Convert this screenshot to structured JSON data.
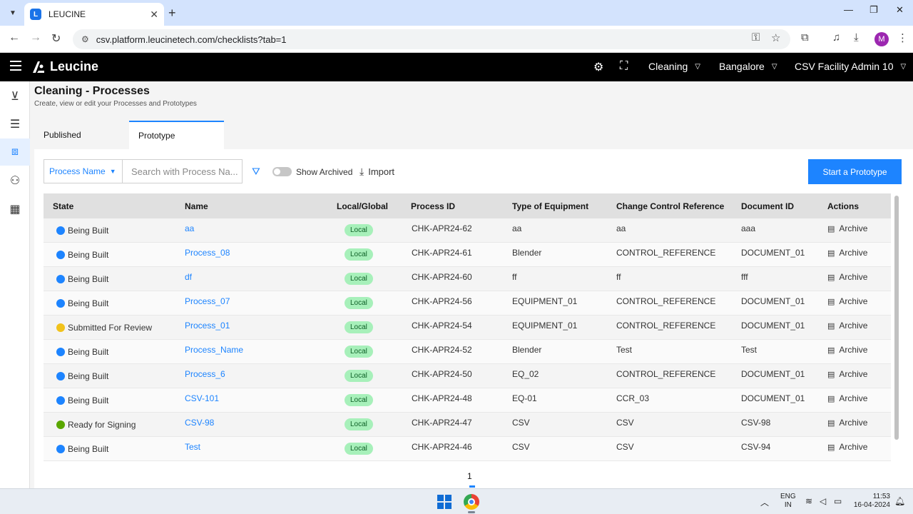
{
  "browser": {
    "tab_title": "LEUCINE",
    "url": "csv.platform.leucinetech.com/checklists?tab=1",
    "avatar_letter": "M"
  },
  "header": {
    "brand": "Leucine",
    "use_case": "Cleaning",
    "facility": "Bangalore",
    "user": "CSV Facility Admin 10"
  },
  "page": {
    "title": "Cleaning - Processes",
    "subtitle": "Create, view or edit your Processes and Prototypes",
    "tabs": [
      {
        "label": "Published"
      },
      {
        "label": "Prototype"
      }
    ]
  },
  "toolbar": {
    "filter_field": "Process Name",
    "search_placeholder": "Search with Process Na...",
    "show_archived_label": "Show Archived",
    "import_label": "Import",
    "primary_label": "Start a Prototype"
  },
  "table": {
    "headers": {
      "state": "State",
      "name": "Name",
      "local_global": "Local/Global",
      "process_id": "Process ID",
      "equipment": "Type of Equipment",
      "ccr": "Change Control Reference",
      "doc_id": "Document ID",
      "actions": "Actions"
    },
    "rows": [
      {
        "state": "Being Built",
        "state_color": "#1d84ff",
        "name": "aa",
        "scope": "Local",
        "pid": "CHK-APR24-62",
        "equipment": "aa",
        "ccr": "aa",
        "doc": "aaa",
        "action": "Archive"
      },
      {
        "state": "Being Built",
        "state_color": "#1d84ff",
        "name": "Process_08",
        "scope": "Local",
        "pid": "CHK-APR24-61",
        "equipment": "Blender",
        "ccr": "CONTROL_REFERENCE",
        "doc": "DOCUMENT_01",
        "action": "Archive"
      },
      {
        "state": "Being Built",
        "state_color": "#1d84ff",
        "name": "df",
        "scope": "Local",
        "pid": "CHK-APR24-60",
        "equipment": "ff",
        "ccr": "ff",
        "doc": "fff",
        "action": "Archive"
      },
      {
        "state": "Being Built",
        "state_color": "#1d84ff",
        "name": "Process_07",
        "scope": "Local",
        "pid": "CHK-APR24-56",
        "equipment": "EQUIPMENT_01",
        "ccr": "CONTROL_REFERENCE",
        "doc": "DOCUMENT_01",
        "action": "Archive"
      },
      {
        "state": "Submitted For Review",
        "state_color": "#f1c21b",
        "name": "Process_01",
        "scope": "Local",
        "pid": "CHK-APR24-54",
        "equipment": "EQUIPMENT_01",
        "ccr": "CONTROL_REFERENCE",
        "doc": "DOCUMENT_01",
        "action": "Archive"
      },
      {
        "state": "Being Built",
        "state_color": "#1d84ff",
        "name": "Process_Name",
        "scope": "Local",
        "pid": "CHK-APR24-52",
        "equipment": "Blender",
        "ccr": "Test",
        "doc": "Test",
        "action": "Archive"
      },
      {
        "state": "Being Built",
        "state_color": "#1d84ff",
        "name": "Process_6",
        "scope": "Local",
        "pid": "CHK-APR24-50",
        "equipment": "EQ_02",
        "ccr": "CONTROL_REFERENCE",
        "doc": "DOCUMENT_01",
        "action": "Archive"
      },
      {
        "state": "Being Built",
        "state_color": "#1d84ff",
        "name": "CSV-101",
        "scope": "Local",
        "pid": "CHK-APR24-48",
        "equipment": "EQ-01",
        "ccr": "CCR_03",
        "doc": "DOCUMENT_01",
        "action": "Archive"
      },
      {
        "state": "Ready for Signing",
        "state_color": "#5aa700",
        "name": "CSV-98",
        "scope": "Local",
        "pid": "CHK-APR24-47",
        "equipment": "CSV",
        "ccr": "CSV",
        "doc": "CSV-98",
        "action": "Archive"
      },
      {
        "state": "Being Built",
        "state_color": "#1d84ff",
        "name": "Test",
        "scope": "Local",
        "pid": "CHK-APR24-46",
        "equipment": "CSV",
        "ccr": "CSV",
        "doc": "CSV-94",
        "action": "Archive"
      }
    ]
  },
  "pagination": {
    "current": "1"
  },
  "taskbar": {
    "lang_1": "ENG",
    "lang_2": "IN",
    "time": "11:53",
    "date": "16-04-2024"
  },
  "colors": {
    "accent": "#1d84ff",
    "header_bg": "#000000"
  }
}
